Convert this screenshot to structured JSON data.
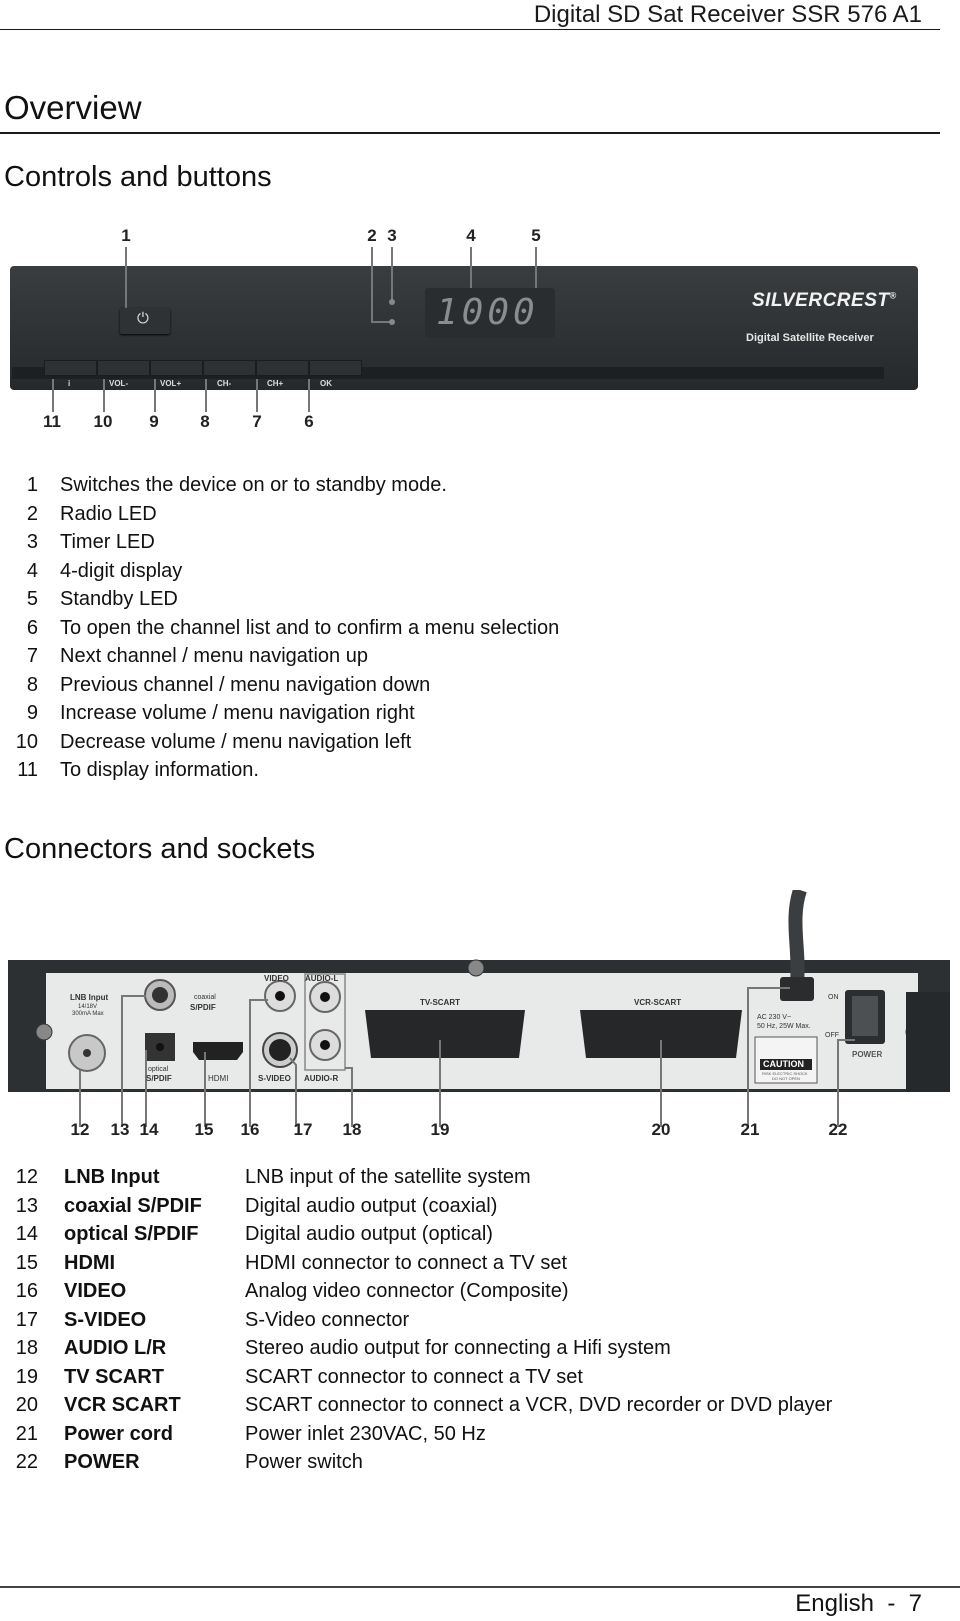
{
  "header": {
    "title": "Digital SD Sat Receiver SSR 576 A1"
  },
  "section_title": "Overview",
  "controls": {
    "title": "Controls and buttons",
    "figure": {
      "brand": "SILVERCREST",
      "brand_mark": "®",
      "subtitle": "Digital Satellite Receiver",
      "display_value": "1000",
      "buttons": [
        "i",
        "VOL-",
        "VOL+",
        "CH-",
        "CH+",
        "OK"
      ],
      "callouts_top": [
        "1",
        "2",
        "3",
        "4",
        "5"
      ],
      "callouts_bottom": [
        "11",
        "10",
        "9",
        "8",
        "7",
        "6"
      ]
    },
    "items": [
      {
        "num": "1",
        "text": "Switches the device on or to standby mode."
      },
      {
        "num": "2",
        "text": "Radio LED"
      },
      {
        "num": "3",
        "text": "Timer LED"
      },
      {
        "num": "4",
        "text": "4-digit display"
      },
      {
        "num": "5",
        "text": "Standby LED"
      },
      {
        "num": "6",
        "text": "To open the channel list and to confirm a menu selection"
      },
      {
        "num": "7",
        "text": "Next channel / menu navigation up"
      },
      {
        "num": "8",
        "text": "Previous channel / menu navigation down"
      },
      {
        "num": "9",
        "text": "Increase volume / menu navigation right"
      },
      {
        "num": "10",
        "text": "Decrease volume / menu navigation left"
      },
      {
        "num": "11",
        "text": "To display information."
      }
    ]
  },
  "connectors": {
    "title": "Connectors and sockets",
    "figure": {
      "labels": {
        "lnb": "LNB Input",
        "lnb_spec1": "14/18V",
        "lnb_spec2": "300mA Max",
        "coaxial1": "coaxial",
        "coaxial2": "S/PDIF",
        "optical1": "optical",
        "optical2": "S/PDIF",
        "hdmi": "HDMI",
        "video": "VIDEO",
        "audio_l": "AUDIO-L",
        "svideo": "S-VIDEO",
        "audio_r": "AUDIO-R",
        "tv_scart": "TV-SCART",
        "vcr_scart": "VCR-SCART",
        "ac1": "AC 230 V~",
        "ac2": "50 Hz, 25W Max.",
        "caution": "CAUTION",
        "caution_small1": "RISK ELECTRIC SHOCK",
        "caution_small2": "DO NOT OPEN",
        "on": "ON",
        "off": "OFF",
        "power": "POWER"
      },
      "callouts": [
        "12",
        "13",
        "14",
        "15",
        "16",
        "17",
        "18",
        "19",
        "20",
        "21",
        "22"
      ]
    },
    "items": [
      {
        "num": "12",
        "name": "LNB Input",
        "desc": "LNB input of the satellite system"
      },
      {
        "num": "13",
        "name": "coaxial S/PDIF",
        "desc": "Digital audio output (coaxial)"
      },
      {
        "num": "14",
        "name": "optical S/PDIF",
        "desc": "Digital audio output (optical)"
      },
      {
        "num": "15",
        "name": "HDMI",
        "desc": "HDMI connector to connect a TV set"
      },
      {
        "num": "16",
        "name": "VIDEO",
        "desc": "Analog video connector (Composite)"
      },
      {
        "num": "17",
        "name": "S-VIDEO",
        "desc": "S-Video connector"
      },
      {
        "num": "18",
        "name": "AUDIO L/R",
        "desc": "Stereo audio output for connecting a Hifi system"
      },
      {
        "num": "19",
        "name": "TV SCART",
        "desc": "SCART connector to connect a TV set"
      },
      {
        "num": "20",
        "name": "VCR SCART",
        "desc": "SCART connector to connect a VCR, DVD recorder or DVD player"
      },
      {
        "num": "21",
        "name": "Power cord",
        "desc": "Power inlet 230VAC, 50 Hz"
      },
      {
        "num": "22",
        "name": "POWER",
        "desc": "Power switch"
      }
    ]
  },
  "footer": {
    "text": "English  -  7"
  }
}
